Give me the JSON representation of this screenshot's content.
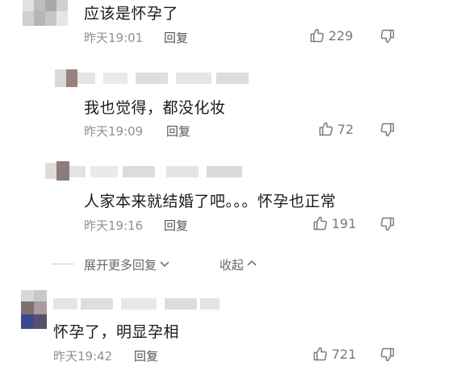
{
  "comments": [
    {
      "text": "应该是怀孕了",
      "time": "昨天19:01",
      "reply": "回复",
      "likes": "229"
    },
    {
      "text": "我也觉得，都没化妆",
      "time": "昨天19:09",
      "reply": "回复",
      "likes": "72"
    },
    {
      "text": "人家本来就结婚了吧。。。怀孕也正常",
      "time": "昨天19:16",
      "reply": "回复",
      "likes": "191"
    },
    {
      "text": "怀孕了，明显孕相",
      "time": "昨天19:42",
      "reply": "回复",
      "likes": "721"
    }
  ],
  "thread_controls": {
    "expand_label": "展开更多回复",
    "collapse_label": "收起"
  },
  "icons": {
    "like": "thumbs-up-icon",
    "dislike": "thumbs-down-icon",
    "expand": "chevron-down-icon",
    "collapse": "chevron-up-icon"
  },
  "colors": {
    "text": "#1a1a1a",
    "meta": "#8f8f8f"
  }
}
